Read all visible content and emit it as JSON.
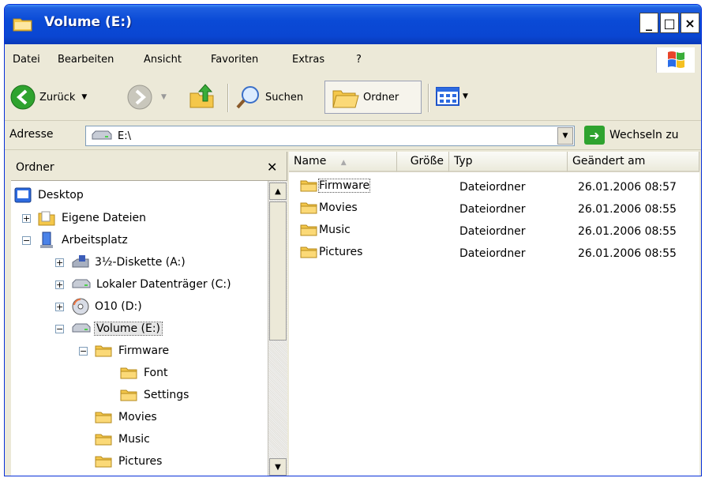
{
  "window": {
    "title": "Volume (E:)"
  },
  "titlebar_buttons": {
    "minimize": "_",
    "maximize": "□",
    "close": "×"
  },
  "menu": [
    "Datei",
    "Bearbeiten",
    "Ansicht",
    "Favoriten",
    "Extras",
    "?"
  ],
  "toolbar": {
    "back": "Zurück",
    "search": "Suchen",
    "folders": "Ordner"
  },
  "address": {
    "label": "Adresse",
    "value": "E:\\",
    "go": "Wechseln zu"
  },
  "folder_pane": {
    "title": "Ordner",
    "tree": [
      {
        "label": "Desktop",
        "icon": "desktop-icon",
        "expander": ""
      },
      {
        "label": "Eigene Dateien",
        "icon": "documents-icon",
        "expander": "+"
      },
      {
        "label": "Arbeitsplatz",
        "icon": "computer-icon",
        "expander": "−"
      },
      {
        "label": "3½-Diskette (A:)",
        "icon": "floppy-icon",
        "expander": "+"
      },
      {
        "label": "Lokaler Datenträger (C:)",
        "icon": "drive-icon",
        "expander": "+"
      },
      {
        "label": "O10 (D:)",
        "icon": "cd-icon",
        "expander": "+"
      },
      {
        "label": "Volume (E:)",
        "icon": "drive-icon",
        "expander": "−",
        "selected": true
      },
      {
        "label": "Firmware",
        "icon": "folder-icon",
        "expander": "−"
      },
      {
        "label": "Font",
        "icon": "folder-icon",
        "expander": ""
      },
      {
        "label": "Settings",
        "icon": "folder-icon",
        "expander": ""
      },
      {
        "label": "Movies",
        "icon": "folder-icon",
        "expander": ""
      },
      {
        "label": "Music",
        "icon": "folder-icon",
        "expander": ""
      },
      {
        "label": "Pictures",
        "icon": "folder-icon",
        "expander": ""
      }
    ]
  },
  "list": {
    "columns": [
      "Name",
      "Größe",
      "Typ",
      "Geändert am"
    ],
    "sort": {
      "column": "Name",
      "direction": "ascending"
    },
    "rows": [
      {
        "name": "Firmware",
        "size": "",
        "type": "Dateiordner",
        "modified": "26.01.2006 08:57"
      },
      {
        "name": "Movies",
        "size": "",
        "type": "Dateiordner",
        "modified": "26.01.2006 08:55"
      },
      {
        "name": "Music",
        "size": "",
        "type": "Dateiordner",
        "modified": "26.01.2006 08:55"
      },
      {
        "name": "Pictures",
        "size": "",
        "type": "Dateiordner",
        "modified": "26.01.2006 08:55"
      }
    ]
  },
  "colors": {
    "titlebar": "#0a46d2",
    "chrome": "#ece9d8",
    "folder": "#f4c74a",
    "go": "#2fa32f"
  }
}
